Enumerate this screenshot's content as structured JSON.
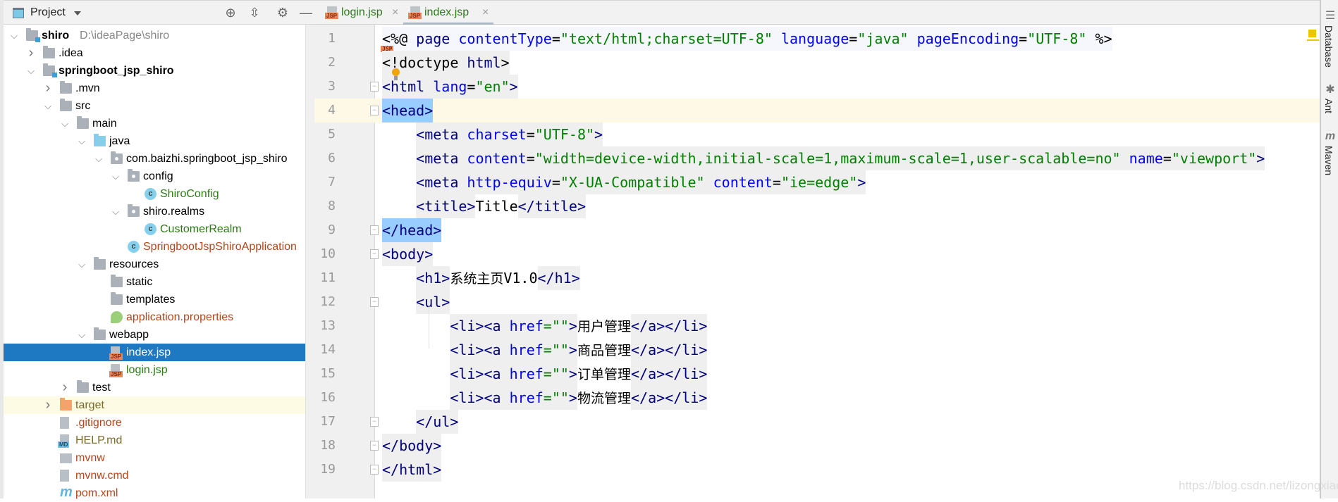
{
  "project_panel": {
    "title": "Project",
    "icons": [
      "locate-icon",
      "collapse-all-icon",
      "gear-icon",
      "minimize-icon"
    ],
    "tree": [
      {
        "label": "shiro",
        "suffix": "D:\\ideaPage\\shiro",
        "depth": 0,
        "arrow": "down",
        "icon": "module-folder",
        "bold": true,
        "color": "#000"
      },
      {
        "label": ".idea",
        "depth": 1,
        "arrow": "right",
        "icon": "folder",
        "color": "#000"
      },
      {
        "label": "springboot_jsp_shiro",
        "depth": 1,
        "arrow": "down",
        "icon": "module-folder",
        "bold": true,
        "color": "#000"
      },
      {
        "label": ".mvn",
        "depth": 2,
        "arrow": "right",
        "icon": "folder",
        "color": "#000"
      },
      {
        "label": "src",
        "depth": 2,
        "arrow": "down",
        "icon": "folder",
        "color": "#000"
      },
      {
        "label": "main",
        "depth": 3,
        "arrow": "down",
        "icon": "folder",
        "color": "#000"
      },
      {
        "label": "java",
        "depth": 4,
        "arrow": "down",
        "icon": "source-folder",
        "color": "#000"
      },
      {
        "label": "com.baizhi.springboot_jsp_shiro",
        "depth": 5,
        "arrow": "down",
        "icon": "package",
        "color": "#000"
      },
      {
        "label": "config",
        "depth": 6,
        "arrow": "down",
        "icon": "package",
        "color": "#000"
      },
      {
        "label": "ShiroConfig",
        "depth": 7,
        "arrow": "none",
        "icon": "class",
        "color": "#2a7a14"
      },
      {
        "label": "shiro.realms",
        "depth": 6,
        "arrow": "down",
        "icon": "package",
        "color": "#000"
      },
      {
        "label": "CustomerRealm",
        "depth": 7,
        "arrow": "none",
        "icon": "class",
        "color": "#2a7a14"
      },
      {
        "label": "SpringbootJspShiroApplication",
        "depth": 6,
        "arrow": "none",
        "icon": "spring-boot-class",
        "color": "#b5451b"
      },
      {
        "label": "resources",
        "depth": 4,
        "arrow": "down",
        "icon": "resources-folder",
        "color": "#000"
      },
      {
        "label": "static",
        "depth": 5,
        "arrow": "none",
        "icon": "folder",
        "color": "#000"
      },
      {
        "label": "templates",
        "depth": 5,
        "arrow": "none",
        "icon": "folder",
        "color": "#000"
      },
      {
        "label": "application.properties",
        "depth": 5,
        "arrow": "none",
        "icon": "spring-properties",
        "color": "#b5451b"
      },
      {
        "label": "webapp",
        "depth": 4,
        "arrow": "down",
        "icon": "folder",
        "color": "#000"
      },
      {
        "label": "index.jsp",
        "depth": 5,
        "arrow": "none",
        "icon": "jsp-file",
        "color": "#fff",
        "selected": true
      },
      {
        "label": "login.jsp",
        "depth": 5,
        "arrow": "none",
        "icon": "jsp-file",
        "color": "#2a7a14"
      },
      {
        "label": "test",
        "depth": 3,
        "arrow": "right",
        "icon": "folder",
        "color": "#000"
      },
      {
        "label": "target",
        "depth": 2,
        "arrow": "right",
        "icon": "excluded-folder",
        "color": "#7a6a2a",
        "highlight": true
      },
      {
        "label": ".gitignore",
        "depth": 2,
        "arrow": "none",
        "icon": "ignore-file",
        "color": "#b5451b"
      },
      {
        "label": "HELP.md",
        "depth": 2,
        "arrow": "none",
        "icon": "markdown-file",
        "color": "#7a6a2a"
      },
      {
        "label": "mvnw",
        "depth": 2,
        "arrow": "none",
        "icon": "shell-file",
        "color": "#b5451b"
      },
      {
        "label": "mvnw.cmd",
        "depth": 2,
        "arrow": "none",
        "icon": "text-file",
        "color": "#b5451b"
      },
      {
        "label": "pom.xml",
        "depth": 2,
        "arrow": "none",
        "icon": "maven-file",
        "color": "#b5451b"
      }
    ]
  },
  "tabs": [
    {
      "label": "login.jsp",
      "active": false
    },
    {
      "label": "index.jsp",
      "active": true
    }
  ],
  "editor": {
    "current_line": 4,
    "lines": [
      {
        "n": "1",
        "indent": 0,
        "fold": false,
        "groups": [
          {
            "bg": "jsp",
            "tokens": [
              [
                "<%@ ",
                "p"
              ],
              [
                "page ",
                "t"
              ],
              [
                "contentType",
                "a"
              ],
              [
                "=",
                "p"
              ],
              [
                "\"text/html;charset=UTF-8\"",
                "v"
              ],
              [
                " ",
                "p"
              ],
              [
                "language",
                "a"
              ],
              [
                "=",
                "p"
              ],
              [
                "\"java\"",
                "v"
              ],
              [
                " ",
                "p"
              ],
              [
                "pageEncoding",
                "a"
              ],
              [
                "=",
                "p"
              ],
              [
                "\"UTF-8\"",
                "v"
              ],
              [
                " %>",
                "p"
              ]
            ]
          }
        ]
      },
      {
        "n": "2",
        "indent": 0,
        "fold": false,
        "groups": [
          {
            "bg": "tag",
            "tokens": [
              [
                "<!doctype ",
                "p"
              ],
              [
                "html",
                "t"
              ],
              [
                ">",
                "p"
              ]
            ]
          }
        ]
      },
      {
        "n": "3",
        "indent": 0,
        "fold": true,
        "groups": [
          {
            "bg": "tag",
            "tokens": [
              [
                "<html ",
                "t"
              ],
              [
                "lang",
                "a"
              ],
              [
                "=",
                "p"
              ],
              [
                "\"en\"",
                "v"
              ],
              [
                ">",
                "t"
              ]
            ]
          }
        ]
      },
      {
        "n": "4",
        "indent": 0,
        "fold": true,
        "groups": [
          {
            "bg": "match",
            "tokens": [
              [
                "<head>",
                "t"
              ]
            ]
          }
        ]
      },
      {
        "n": "5",
        "indent": 4,
        "fold": false,
        "groups": [
          {
            "bg": "tag",
            "tokens": [
              [
                "<meta ",
                "t"
              ],
              [
                "charset",
                "a"
              ],
              [
                "=",
                "p"
              ],
              [
                "\"UTF-8\"",
                "v"
              ],
              [
                ">",
                "t"
              ]
            ]
          }
        ]
      },
      {
        "n": "6",
        "indent": 4,
        "fold": false,
        "groups": [
          {
            "bg": "tag",
            "tokens": [
              [
                "<meta ",
                "t"
              ],
              [
                "content",
                "a"
              ],
              [
                "=",
                "p"
              ],
              [
                "\"width=device-width,initial-scale=1,maximum-scale=1,user-scalable=no\"",
                "v"
              ],
              [
                " ",
                "p"
              ],
              [
                "name",
                "a"
              ],
              [
                "=",
                "p"
              ],
              [
                "\"viewport\"",
                "v"
              ],
              [
                ">",
                "t"
              ]
            ]
          }
        ]
      },
      {
        "n": "7",
        "indent": 4,
        "fold": false,
        "groups": [
          {
            "bg": "tag",
            "tokens": [
              [
                "<meta ",
                "t"
              ],
              [
                "http-equiv",
                "a"
              ],
              [
                "=",
                "p"
              ],
              [
                "\"X-UA-Compatible\"",
                "v"
              ],
              [
                " ",
                "p"
              ],
              [
                "content",
                "a"
              ],
              [
                "=",
                "p"
              ],
              [
                "\"ie=edge\"",
                "v"
              ],
              [
                ">",
                "t"
              ]
            ]
          }
        ]
      },
      {
        "n": "8",
        "indent": 4,
        "fold": false,
        "groups": [
          {
            "bg": "tag",
            "tokens": [
              [
                "<title>",
                "t"
              ]
            ]
          },
          {
            "bg": "none",
            "tokens": [
              [
                "Title",
                "p"
              ]
            ]
          },
          {
            "bg": "tag",
            "tokens": [
              [
                "</title>",
                "t"
              ]
            ]
          }
        ]
      },
      {
        "n": "9",
        "indent": 0,
        "fold": true,
        "groups": [
          {
            "bg": "match",
            "tokens": [
              [
                "</head>",
                "t"
              ]
            ]
          }
        ]
      },
      {
        "n": "10",
        "indent": 0,
        "fold": true,
        "groups": [
          {
            "bg": "tag",
            "tokens": [
              [
                "<body>",
                "t"
              ]
            ]
          }
        ]
      },
      {
        "n": "11",
        "indent": 4,
        "fold": false,
        "groups": [
          {
            "bg": "tag",
            "tokens": [
              [
                "<h1>",
                "t"
              ]
            ]
          },
          {
            "bg": "none",
            "tokens": [
              [
                "系统主页",
                "c"
              ],
              [
                "V1.0",
                "p"
              ]
            ]
          },
          {
            "bg": "tag",
            "tokens": [
              [
                "</h1>",
                "t"
              ]
            ]
          }
        ]
      },
      {
        "n": "12",
        "indent": 4,
        "fold": true,
        "groups": [
          {
            "bg": "tag",
            "tokens": [
              [
                "<ul>",
                "t"
              ]
            ]
          }
        ]
      },
      {
        "n": "13",
        "indent": 8,
        "fold": false,
        "groups": [
          {
            "bg": "tag",
            "tokens": [
              [
                "<li><a ",
                "t"
              ],
              [
                "href",
                "a"
              ],
              [
                "=",
                "v"
              ],
              [
                "\"\"",
                "v"
              ],
              [
                ">",
                "t"
              ]
            ]
          },
          {
            "bg": "none",
            "tokens": [
              [
                "用户管理",
                "c"
              ]
            ]
          },
          {
            "bg": "tag",
            "tokens": [
              [
                "</a></li>",
                "t"
              ]
            ]
          }
        ]
      },
      {
        "n": "14",
        "indent": 8,
        "fold": false,
        "groups": [
          {
            "bg": "tag",
            "tokens": [
              [
                "<li><a ",
                "t"
              ],
              [
                "href",
                "a"
              ],
              [
                "=",
                "v"
              ],
              [
                "\"\"",
                "v"
              ],
              [
                ">",
                "t"
              ]
            ]
          },
          {
            "bg": "none",
            "tokens": [
              [
                "商品管理",
                "c"
              ]
            ]
          },
          {
            "bg": "tag",
            "tokens": [
              [
                "</a></li>",
                "t"
              ]
            ]
          }
        ]
      },
      {
        "n": "15",
        "indent": 8,
        "fold": false,
        "groups": [
          {
            "bg": "tag",
            "tokens": [
              [
                "<li><a ",
                "t"
              ],
              [
                "href",
                "a"
              ],
              [
                "=",
                "v"
              ],
              [
                "\"\"",
                "v"
              ],
              [
                ">",
                "t"
              ]
            ]
          },
          {
            "bg": "none",
            "tokens": [
              [
                "订单管理",
                "c"
              ]
            ]
          },
          {
            "bg": "tag",
            "tokens": [
              [
                "</a></li>",
                "t"
              ]
            ]
          }
        ]
      },
      {
        "n": "16",
        "indent": 8,
        "fold": false,
        "groups": [
          {
            "bg": "tag",
            "tokens": [
              [
                "<li><a ",
                "t"
              ],
              [
                "href",
                "a"
              ],
              [
                "=",
                "v"
              ],
              [
                "\"\"",
                "v"
              ],
              [
                ">",
                "t"
              ]
            ]
          },
          {
            "bg": "none",
            "tokens": [
              [
                "物流管理",
                "c"
              ]
            ]
          },
          {
            "bg": "tag",
            "tokens": [
              [
                "</a></li>",
                "t"
              ]
            ]
          }
        ]
      },
      {
        "n": "17",
        "indent": 4,
        "fold": true,
        "groups": [
          {
            "bg": "tag",
            "tokens": [
              [
                "</ul>",
                "t"
              ]
            ]
          }
        ]
      },
      {
        "n": "18",
        "indent": 0,
        "fold": true,
        "groups": [
          {
            "bg": "tag",
            "tokens": [
              [
                "</body>",
                "t"
              ]
            ]
          }
        ]
      },
      {
        "n": "19",
        "indent": 0,
        "fold": true,
        "groups": [
          {
            "bg": "tag",
            "tokens": [
              [
                "</html>",
                "t"
              ]
            ]
          }
        ]
      }
    ]
  },
  "right_toolbar": [
    {
      "label": "Database",
      "icon": "database-icon"
    },
    {
      "label": "Ant",
      "icon": "ant-icon"
    },
    {
      "label": "Maven",
      "icon": "maven-icon"
    }
  ],
  "watermark": "https://blog.csdn.net/lizongxiao",
  "colors": {
    "selection": "#1e78c2",
    "tag": "#000080",
    "attribute": "#0000ff",
    "value": "#008000",
    "current_line": "#fdf9e6",
    "brace_match": "#99ccff"
  }
}
